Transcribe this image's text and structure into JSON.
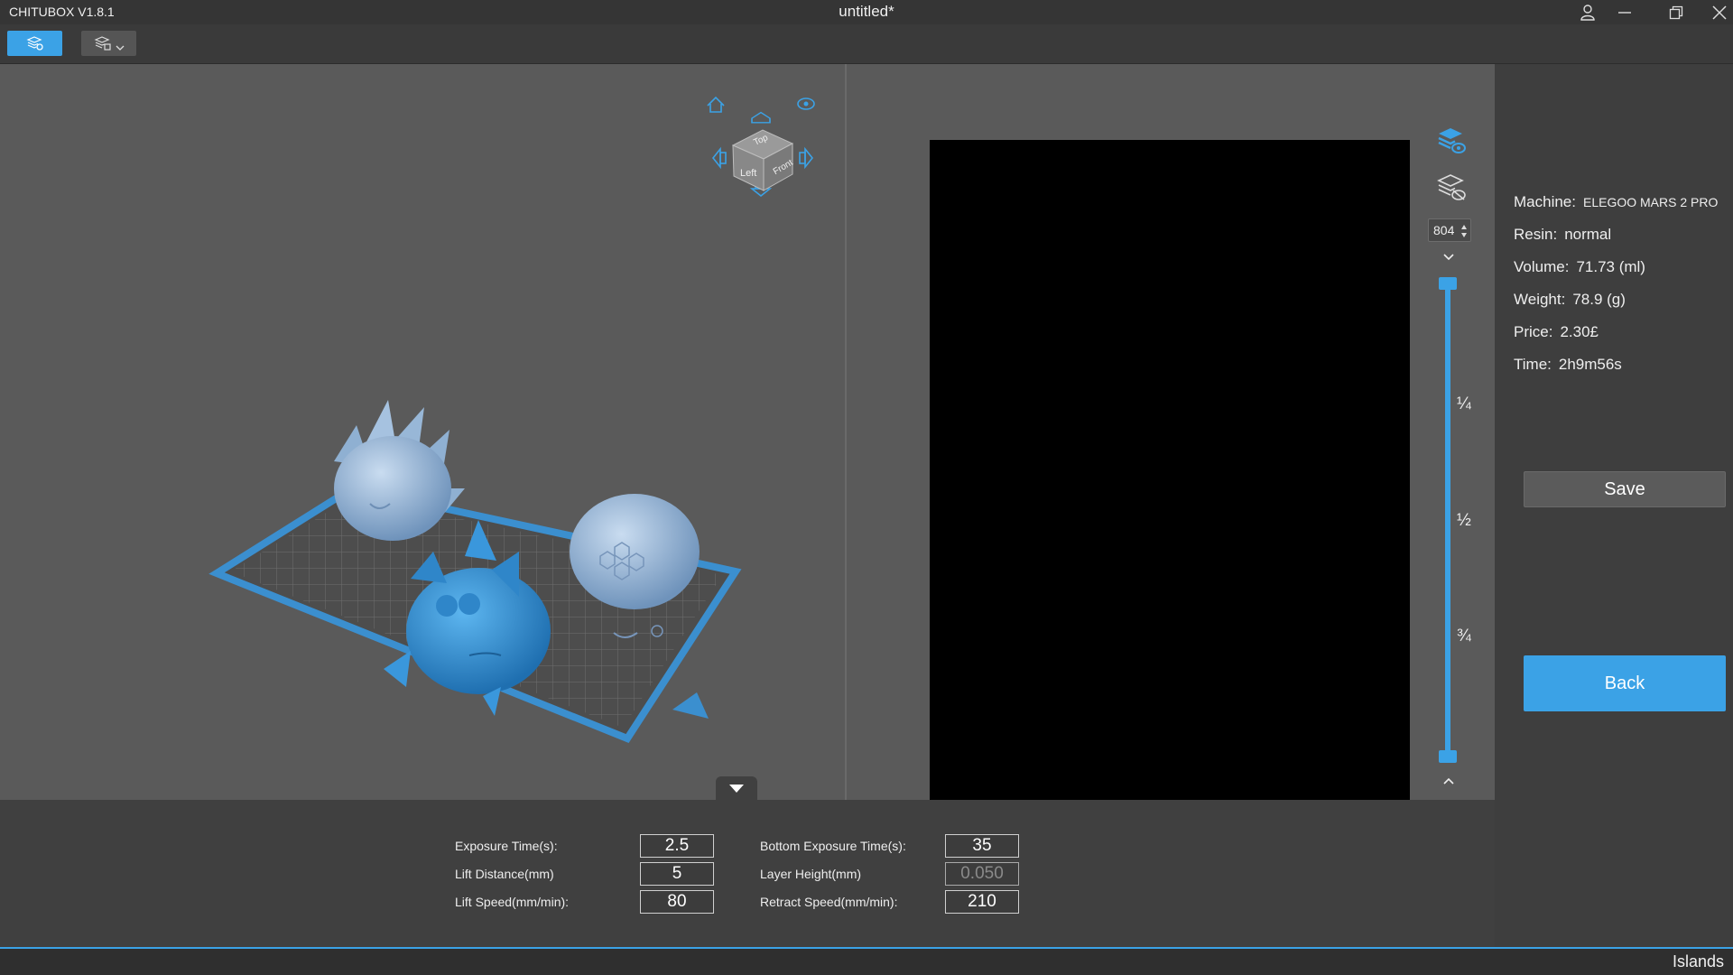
{
  "window": {
    "app_title": "CHITUBOX V1.8.1",
    "doc_title": "untitled*",
    "icons": [
      "user-icon",
      "minimize-icon",
      "restore-icon",
      "close-icon"
    ]
  },
  "toolbar": {
    "buttons": [
      {
        "name": "slice-view-button",
        "icon": "layers-gear-icon",
        "active": true
      },
      {
        "name": "slice-settings-dropdown",
        "icon": "layers-settings-icon",
        "active": false
      }
    ]
  },
  "view_cube": {
    "top": "Top",
    "left": "Left",
    "front": "Front"
  },
  "layer_control": {
    "layer_value": "804",
    "fractions": [
      "¼",
      "½",
      "¾"
    ]
  },
  "info": {
    "machine_label": "Machine:",
    "machine_value": "ELEGOO MARS 2 PRO",
    "resin_label": "Resin:",
    "resin_value": "normal",
    "volume_label": "Volume:",
    "volume_value": "71.73  (ml)",
    "weight_label": "Weight:",
    "weight_value": "78.9  (g)",
    "price_label": "Price:",
    "price_value": "2.30£",
    "time_label": "Time:",
    "time_value": "2h9m56s",
    "save_label": "Save",
    "back_label": "Back"
  },
  "settings": {
    "exposure_label": "Exposure Time(s):",
    "exposure_value": "2.5",
    "lift_distance_label": "Lift Distance(mm)",
    "lift_distance_value": "5",
    "lift_speed_label": "Lift Speed(mm/min):",
    "lift_speed_value": "80",
    "bottom_exposure_label": "Bottom Exposure Time(s):",
    "bottom_exposure_value": "35",
    "layer_height_label": "Layer Height(mm)",
    "layer_height_value": "0.050",
    "retract_speed_label": "Retract Speed(mm/min):",
    "retract_speed_value": "210"
  },
  "status": {
    "text": "Islands"
  },
  "colors": {
    "accent": "#3ba2e6",
    "model_light": "#8fb0d2",
    "model_selected": "#3a97dc",
    "canvas": "#000000"
  }
}
